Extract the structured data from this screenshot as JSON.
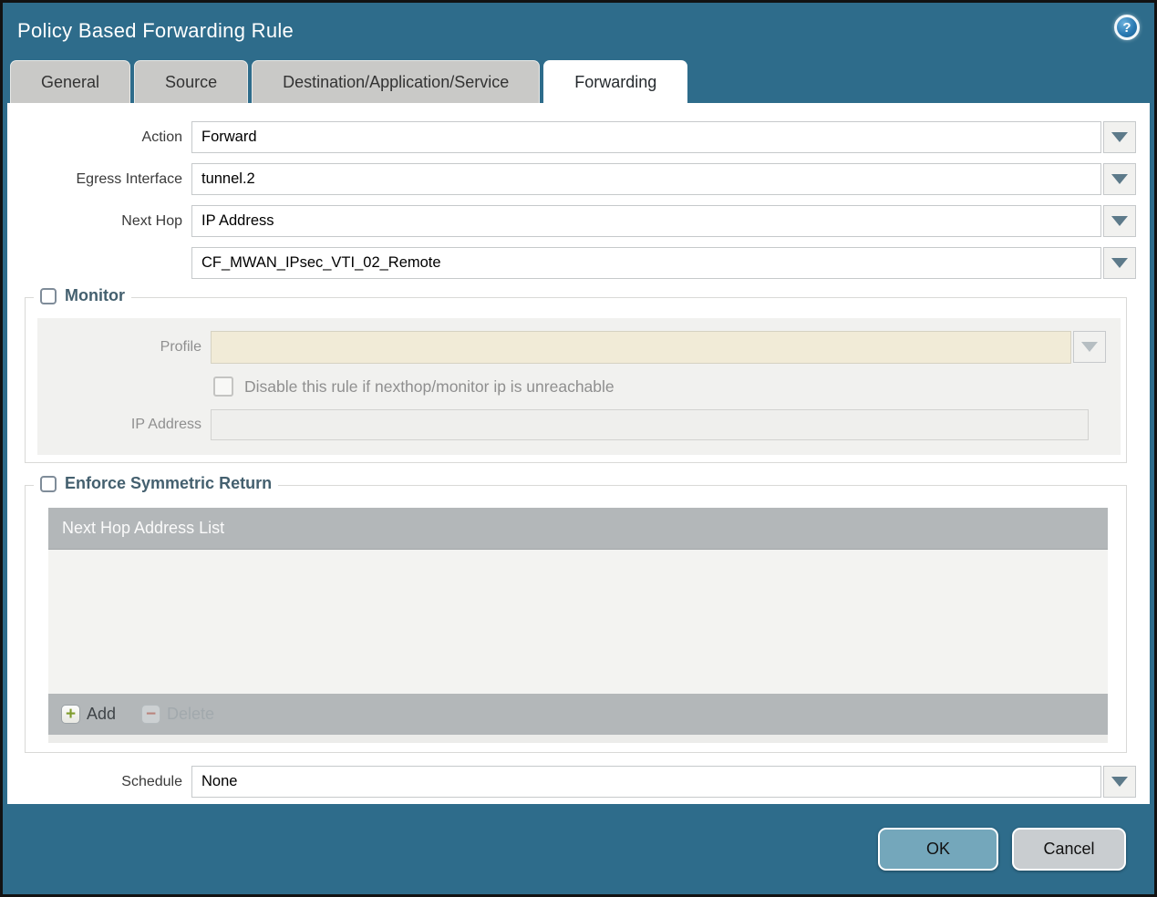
{
  "dialog": {
    "title": "Policy Based Forwarding Rule",
    "help_glyph": "?"
  },
  "tabs": [
    {
      "label": "General",
      "active": false
    },
    {
      "label": "Source",
      "active": false
    },
    {
      "label": "Destination/Application/Service",
      "active": false
    },
    {
      "label": "Forwarding",
      "active": true
    }
  ],
  "form": {
    "action": {
      "label": "Action",
      "value": "Forward"
    },
    "egress_interface": {
      "label": "Egress Interface",
      "value": "tunnel.2"
    },
    "next_hop": {
      "label": "Next Hop",
      "value": "IP Address"
    },
    "next_hop_address": {
      "value": "CF_MWAN_IPsec_VTI_02_Remote"
    },
    "schedule": {
      "label": "Schedule",
      "value": "None"
    }
  },
  "monitor": {
    "legend": "Monitor",
    "checked": false,
    "profile": {
      "label": "Profile",
      "value": ""
    },
    "disable_rule": {
      "label": "Disable this rule if nexthop/monitor ip is unreachable",
      "checked": false
    },
    "ip_address": {
      "label": "IP Address",
      "value": ""
    }
  },
  "symmetric_return": {
    "legend": "Enforce Symmetric Return",
    "checked": false,
    "table": {
      "header": "Next Hop Address List",
      "rows": []
    },
    "add_label": "Add",
    "delete_label": "Delete",
    "add_glyph": "+",
    "delete_glyph": "−"
  },
  "footer": {
    "ok_label": "OK",
    "cancel_label": "Cancel"
  },
  "colors": {
    "frame_teal": "#2e6c8b",
    "ok_button": "#74a7bb",
    "cancel_button": "#c9cdd0",
    "legend_text": "#44606f",
    "table_chrome": "#b3b7b9",
    "profile_field_bg": "#f1ebd7"
  }
}
